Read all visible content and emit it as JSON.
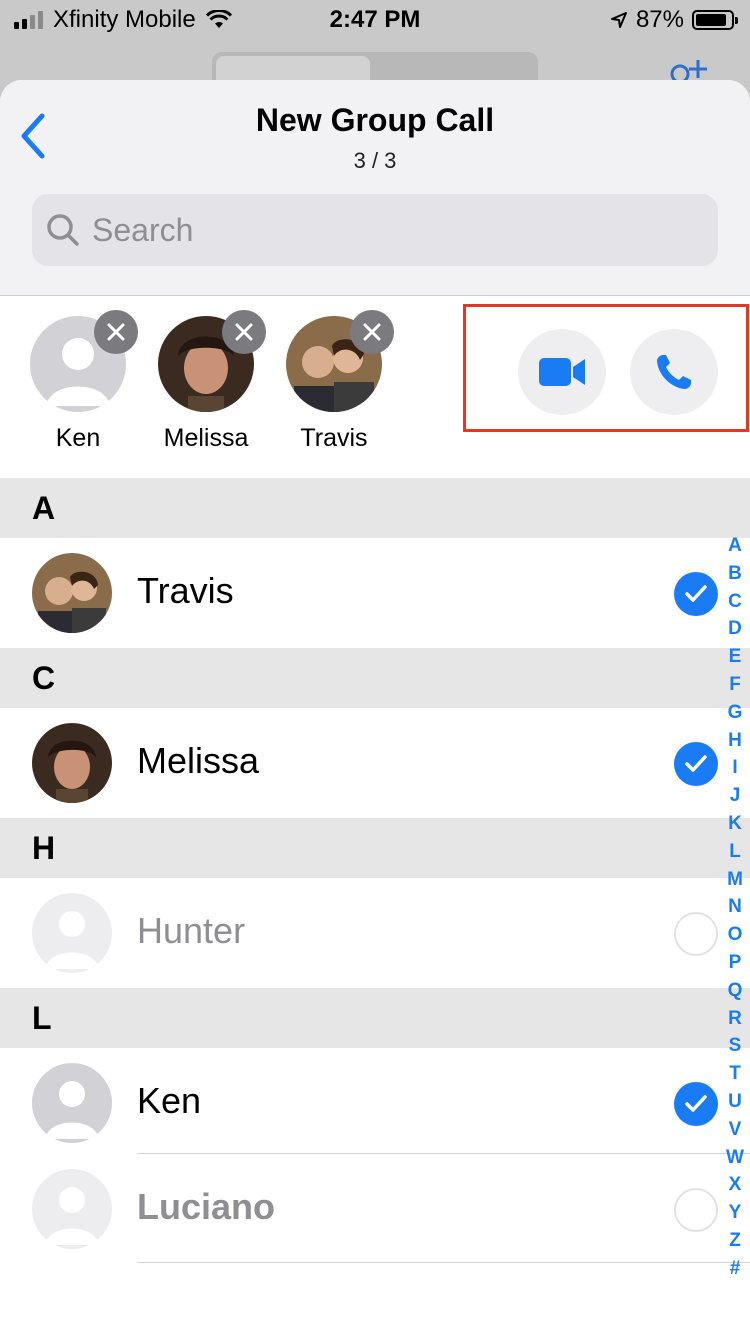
{
  "status_bar": {
    "carrier": "Xfinity Mobile",
    "time": "2:47 PM",
    "battery": "87%"
  },
  "header": {
    "title": "New Group Call",
    "count": "3 / 3"
  },
  "search": {
    "placeholder": "Search"
  },
  "selected": [
    {
      "name": "Ken",
      "photo": "placeholder"
    },
    {
      "name": "Melissa",
      "photo": "woman-photo"
    },
    {
      "name": "Travis",
      "photo": "couple-photo"
    }
  ],
  "actions": {
    "video": "video-icon",
    "audio": "phone-icon"
  },
  "list": {
    "sections": [
      {
        "letter": "A",
        "contacts": [
          {
            "name": "Travis",
            "checked": true
          }
        ]
      },
      {
        "letter": "C",
        "contacts": [
          {
            "name": "Melissa",
            "checked": true
          }
        ]
      },
      {
        "letter": "H",
        "contacts": [
          {
            "name": "Hunter",
            "checked": false
          }
        ]
      },
      {
        "letter": "L",
        "contacts": [
          {
            "name": "Ken",
            "checked": true
          },
          {
            "name": "Luciano",
            "checked": false
          }
        ]
      }
    ]
  },
  "index_letters": [
    "A",
    "B",
    "C",
    "D",
    "E",
    "F",
    "G",
    "H",
    "I",
    "J",
    "K",
    "L",
    "M",
    "N",
    "O",
    "P",
    "Q",
    "R",
    "S",
    "T",
    "U",
    "V",
    "W",
    "X",
    "Y",
    "Z",
    "#"
  ],
  "colors": {
    "accent": "#1a7cf5",
    "highlight_box": "#e8361f"
  }
}
